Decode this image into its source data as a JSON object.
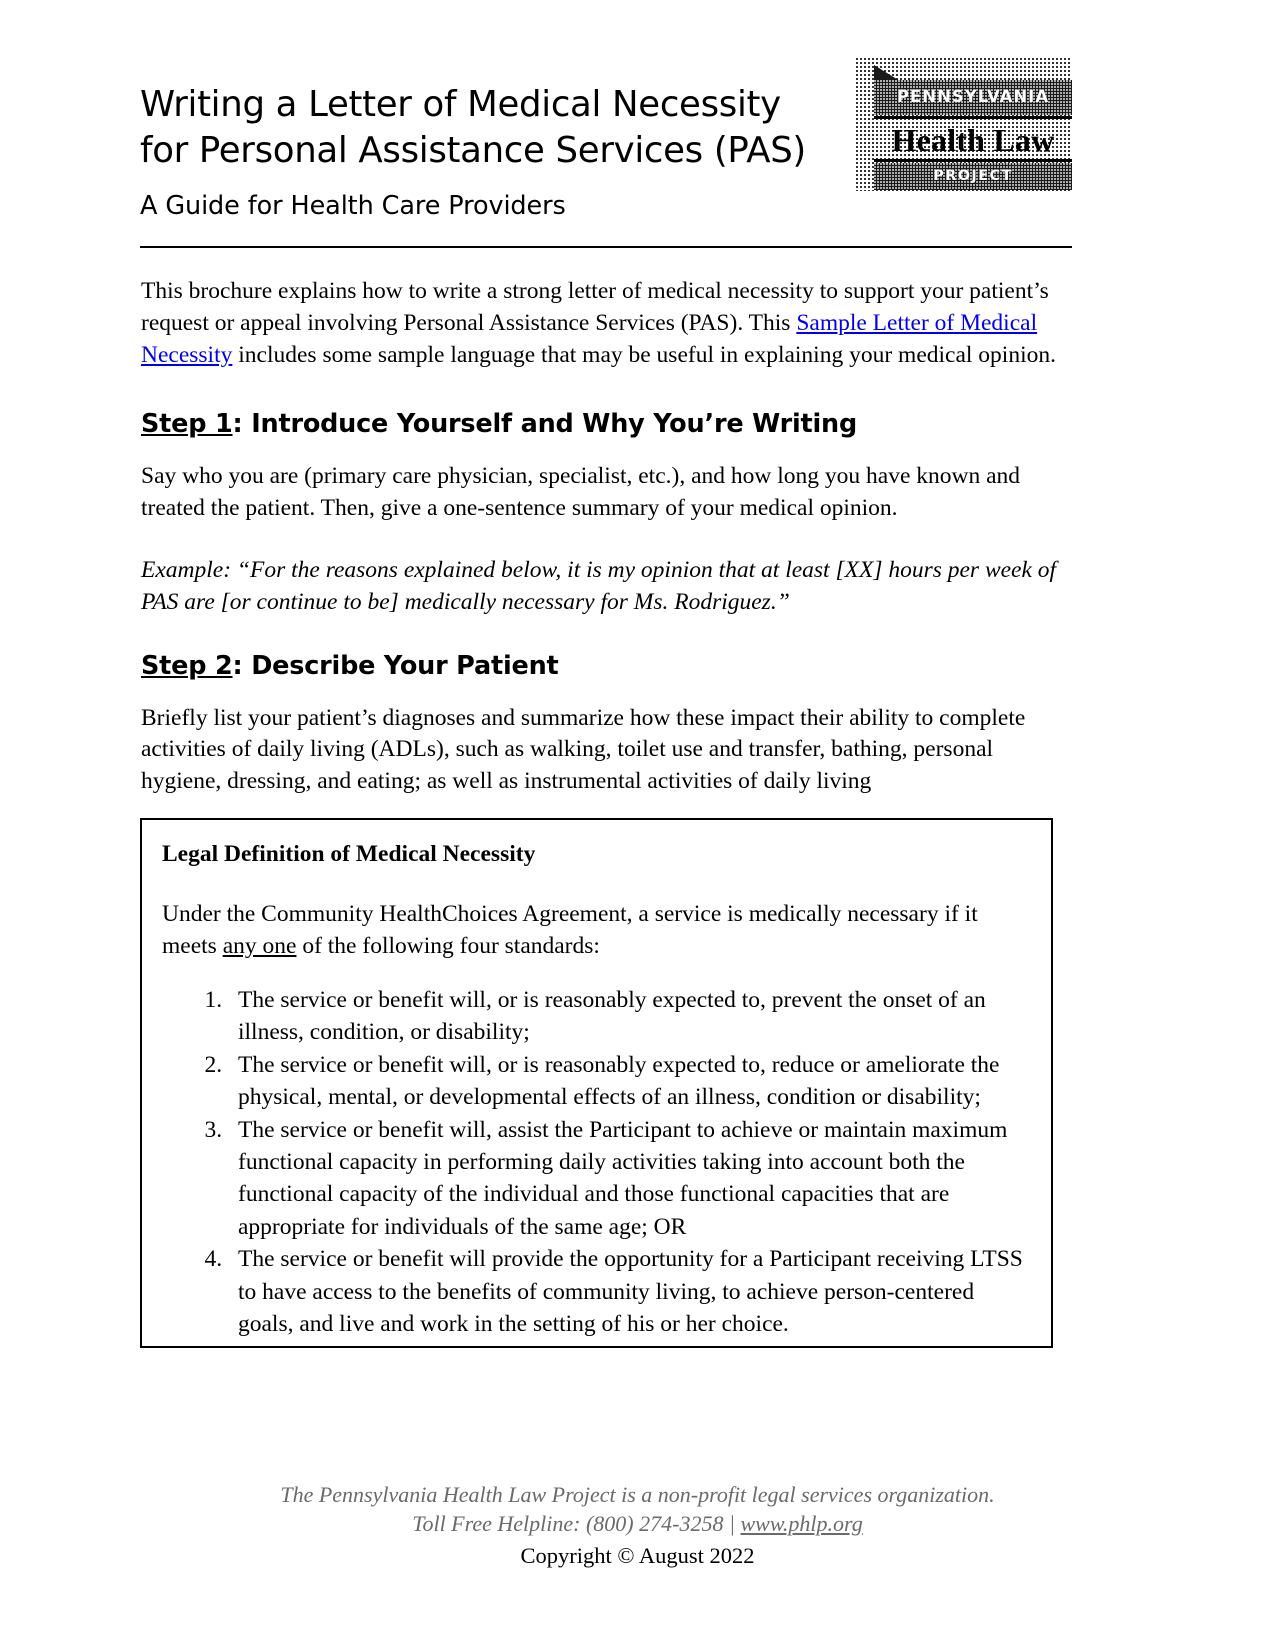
{
  "document": {
    "title_line_1": "Writing a Letter of Medical Necessity",
    "title_line_2": "for Personal Assistance Services (PAS)",
    "subtitle": "A Guide for Health Care Providers"
  },
  "logo": {
    "band_top": "PENNSYLVANIA",
    "middle": "Health Law",
    "band_bottom": "PROJECT",
    "alt": "Pennsylvania Health Law Project logo"
  },
  "intro": {
    "part_1": "This brochure explains how to write a strong letter of medical necessity to support your patient’s request or appeal involving Personal Assistance Services (PAS). This ",
    "link": "Sample Letter of Medical Necessity",
    "part_2": " includes some sample language that may be useful in explaining your medical opinion."
  },
  "steps": [
    {
      "label": "Step 1",
      "title": ":  Introduce Yourself and Why You’re Writing",
      "body": "Say who you are (primary care physician, specialist, etc.), and how long you have known and treated the patient. Then, give a one-sentence summary of your medical opinion.",
      "example": "Example: “For the reasons explained below, it is my opinion that at least [XX] hours per week of PAS are [or continue to be] medically necessary for Ms. Rodriguez.”"
    },
    {
      "label": "Step 2",
      "title": ": Describe Your Patient",
      "body": "Briefly list your patient’s diagnoses and summarize how these impact their ability to complete activities of daily living (ADLs), such as walking, toilet use and transfer, bathing, personal hygiene, dressing, and eating; as well as instrumental activities of daily living"
    }
  ],
  "callout": {
    "title": "Legal Definition of Medical Necessity",
    "intro_part_1": "Under the Community HealthChoices Agreement, a service is medically necessary if it meets ",
    "intro_emphasis": "any one",
    "intro_part_2": " of the following four standards:",
    "standards": [
      "The service or benefit will, or is reasonably expected to, prevent the onset of an illness, condition, or disability;",
      "The service or benefit will, or is reasonably expected to, reduce or ameliorate the physical, mental, or developmental effects of an illness, condition or disability;",
      "The service or benefit will, assist the Participant to achieve or maintain maximum functional capacity in performing daily activities taking into account both the functional capacity of the individual and those functional capacities that are appropriate for individuals of the same age; OR",
      "The service or benefit will provide the opportunity for a Participant receiving LTSS to have access to the benefits of community living, to achieve person-centered goals, and live and work in the setting of his or her choice."
    ]
  },
  "footer": {
    "line_1": "The Pennsylvania Health Law Project is a non-profit legal services organization.",
    "line_2_prefix": "Toll Free Helpline: (800) 274-3258 | ",
    "line_2_link": "www.phlp.org",
    "copyright": "Copyright © August 2022"
  }
}
